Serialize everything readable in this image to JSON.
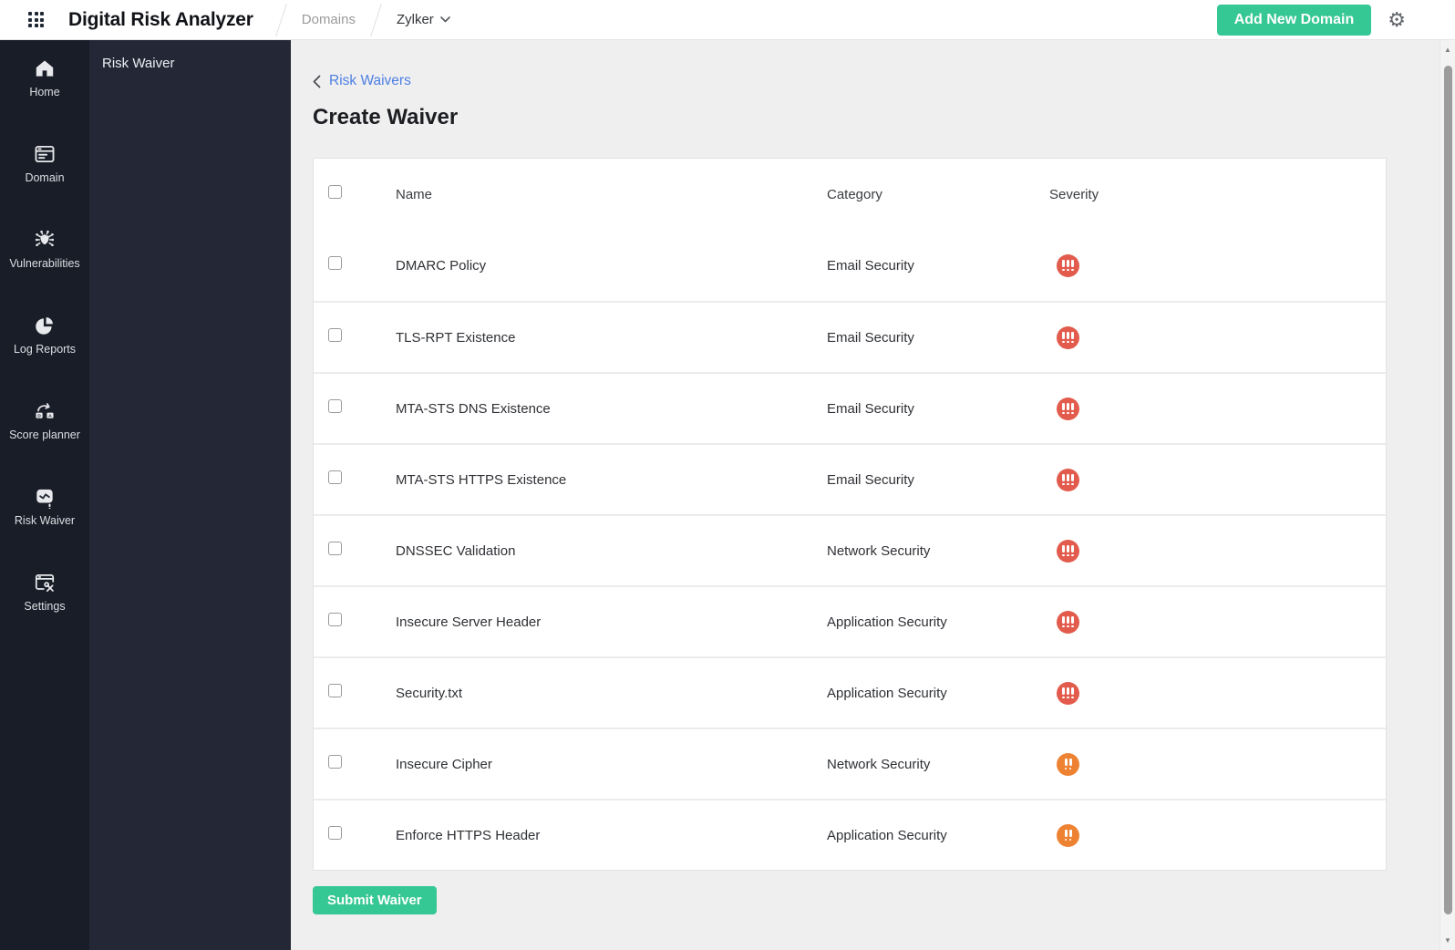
{
  "topbar": {
    "app_title": "Digital Risk Analyzer",
    "breadcrumb": {
      "section": "Domains",
      "domain": "Zylker"
    },
    "add_domain_label": "Add New Domain"
  },
  "sidebar": {
    "items": [
      {
        "label": "Home",
        "icon": "home-icon"
      },
      {
        "label": "Domain",
        "icon": "domain-icon"
      },
      {
        "label": "Vulnerabilities",
        "icon": "vulnerabilities-icon"
      },
      {
        "label": "Log Reports",
        "icon": "log-reports-icon"
      },
      {
        "label": "Score planner",
        "icon": "score-planner-icon"
      },
      {
        "label": "Risk Waiver",
        "icon": "risk-waiver-icon"
      },
      {
        "label": "Settings",
        "icon": "settings-icon"
      }
    ]
  },
  "panel": {
    "title": "Risk Waiver"
  },
  "main": {
    "back_link": "Risk Waivers",
    "page_title": "Create Waiver",
    "table": {
      "headers": {
        "name": "Name",
        "category": "Category",
        "severity": "Severity"
      },
      "severity_styles": {
        "critical": {
          "color": "#e25b4c",
          "bangs": 3
        },
        "high": {
          "color": "#ee8233",
          "bangs": 2
        }
      },
      "rows": [
        {
          "name": "DMARC Policy",
          "category": "Email Security",
          "severity": "critical",
          "checked": false
        },
        {
          "name": "TLS-RPT Existence",
          "category": "Email Security",
          "severity": "critical",
          "checked": false
        },
        {
          "name": "MTA-STS DNS Existence",
          "category": "Email Security",
          "severity": "critical",
          "checked": false
        },
        {
          "name": "MTA-STS HTTPS Existence",
          "category": "Email Security",
          "severity": "critical",
          "checked": false
        },
        {
          "name": "DNSSEC Validation",
          "category": "Network Security",
          "severity": "critical",
          "checked": false
        },
        {
          "name": "Insecure Server Header",
          "category": "Application Security",
          "severity": "critical",
          "checked": false
        },
        {
          "name": "Security.txt",
          "category": "Application Security",
          "severity": "critical",
          "checked": false
        },
        {
          "name": "Insecure Cipher",
          "category": "Network Security",
          "severity": "high",
          "checked": false
        },
        {
          "name": "Enforce HTTPS Header",
          "category": "Application Security",
          "severity": "high",
          "checked": false
        }
      ]
    },
    "submit_label": "Submit Waiver"
  },
  "colors": {
    "accent_green": "#35c794",
    "severity_critical": "#e25b4c",
    "severity_high": "#ee8233",
    "link_blue": "#4d7fe3",
    "sidebar_bg": "#191d28",
    "panel_bg": "#242836"
  }
}
